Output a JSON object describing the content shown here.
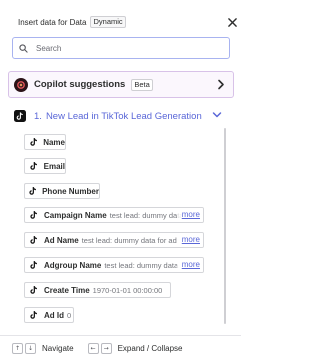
{
  "header": {
    "title": "Insert data for Data",
    "badge": "Dynamic"
  },
  "search": {
    "placeholder": "Search"
  },
  "copilot": {
    "label": "Copilot suggestions",
    "badge": "Beta"
  },
  "section": {
    "number": "1.",
    "title": "New Lead in TikTok Lead Generation"
  },
  "fields": [
    {
      "label": "Name",
      "value": "",
      "more": ""
    },
    {
      "label": "Email",
      "value": "",
      "more": ""
    },
    {
      "label": "Phone Number",
      "value": "",
      "more": ""
    },
    {
      "label": "Campaign Name",
      "value": "test lead: dummy data",
      "more": "more"
    },
    {
      "label": "Ad Name",
      "value": "test lead: dummy data for ad",
      "more": "more"
    },
    {
      "label": "Adgroup Name",
      "value": "test lead: dummy data",
      "more": "more"
    },
    {
      "label": "Create Time",
      "value": "1970-01-01 00:00:00",
      "more": ""
    },
    {
      "label": "Ad Id",
      "value": "0",
      "more": ""
    }
  ],
  "footer": {
    "navigate_label": "Navigate",
    "expand_label": "Expand / Collapse",
    "keys": {
      "up": "↑",
      "down": "↓",
      "left": "←",
      "right": "→"
    }
  },
  "colors": {
    "accent": "#5a67d8",
    "copilot_border": "#d8c2e8",
    "search_border": "#a8b3f0"
  },
  "icons": [
    "close-icon",
    "search-icon",
    "copilot-icon",
    "chevron-right-icon",
    "tiktok-icon",
    "chevron-down-icon"
  ]
}
